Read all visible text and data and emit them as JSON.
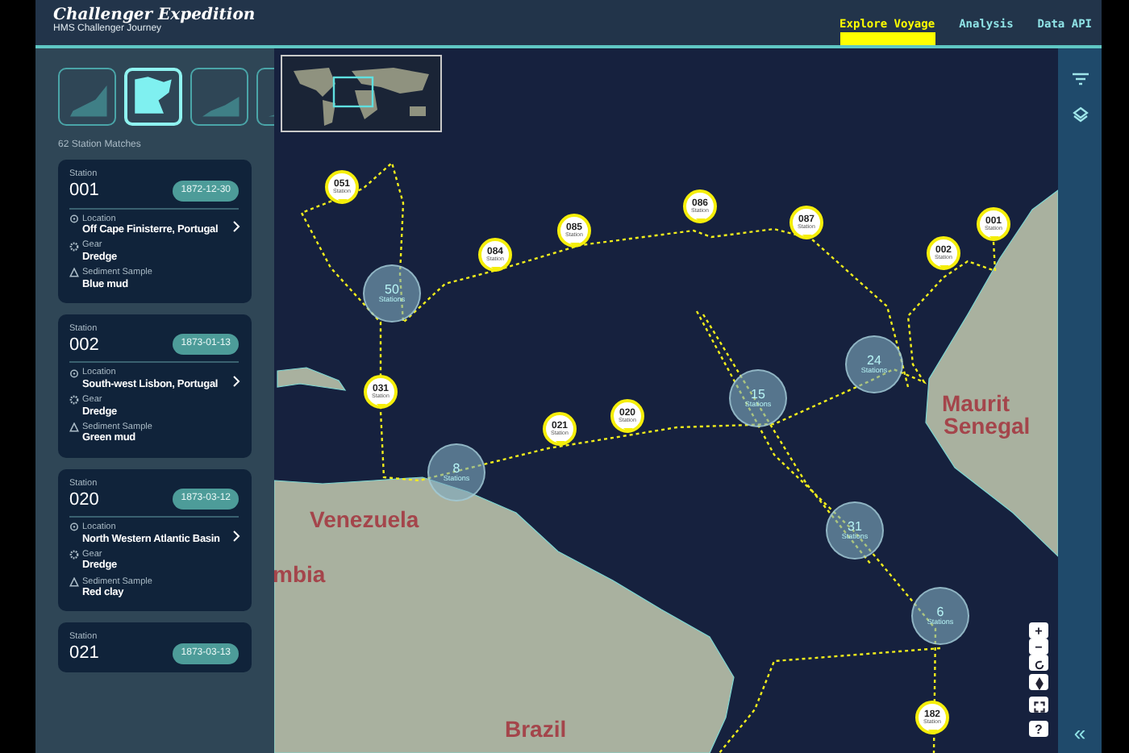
{
  "header": {
    "title": "Challenger Expedition",
    "subtitle": "HMS Challenger Journey",
    "nav": [
      {
        "label": "Explore Voyage",
        "selected": true
      },
      {
        "label": "Analysis",
        "selected": false
      },
      {
        "label": "Data API",
        "selected": false
      }
    ]
  },
  "sidebar": {
    "region_thumbnails": [
      {
        "selected": false
      },
      {
        "selected": true
      },
      {
        "selected": false
      },
      {
        "selected": false
      }
    ],
    "match_count": "62 Station Matches",
    "stations": [
      {
        "station_label": "Station",
        "number": "001",
        "date": "1872-12-30",
        "location_label": "Location",
        "location": "Off Cape Finisterre, Portugal",
        "gear_label": "Gear",
        "gear": "Dredge",
        "sediment_label": "Sediment Sample",
        "sediment": "Blue mud"
      },
      {
        "station_label": "Station",
        "number": "002",
        "date": "1873-01-13",
        "location_label": "Location",
        "location": "South-west Lisbon, Portugal",
        "gear_label": "Gear",
        "gear": "Dredge",
        "sediment_label": "Sediment Sample",
        "sediment": "Green mud"
      },
      {
        "station_label": "Station",
        "number": "020",
        "date": "1873-03-12",
        "location_label": "Location",
        "location": "North Western Atlantic Basin",
        "gear_label": "Gear",
        "gear": "Dredge",
        "sediment_label": "Sediment Sample",
        "sediment": "Red clay"
      },
      {
        "station_label": "Station",
        "number": "021",
        "date": "1873-03-13"
      }
    ]
  },
  "map": {
    "country_labels": [
      "Maurit",
      "Senegal",
      "Venezuela",
      "mbia",
      "Brazil"
    ],
    "pins": [
      {
        "number": "051",
        "caption": "Station"
      },
      {
        "number": "084",
        "caption": "Station"
      },
      {
        "number": "085",
        "caption": "Station"
      },
      {
        "number": "086",
        "caption": "Station"
      },
      {
        "number": "087",
        "caption": "Station"
      },
      {
        "number": "002",
        "caption": "Station"
      },
      {
        "number": "001",
        "caption": "Station"
      },
      {
        "number": "031",
        "caption": "Station"
      },
      {
        "number": "021",
        "caption": "Station"
      },
      {
        "number": "020",
        "caption": "Station"
      },
      {
        "number": "182",
        "caption": "Station"
      }
    ],
    "clusters": [
      {
        "count": "50",
        "caption": "Stations"
      },
      {
        "count": "15",
        "caption": "Stations"
      },
      {
        "count": "24",
        "caption": "Stations"
      },
      {
        "count": "8",
        "caption": "Stations"
      },
      {
        "count": "31",
        "caption": "Stations"
      },
      {
        "count": "6",
        "caption": "Stations"
      }
    ],
    "controls": {
      "zoom_in": "+",
      "zoom_out": "−",
      "help": "?"
    }
  },
  "rail": {
    "collapse": "«"
  }
}
